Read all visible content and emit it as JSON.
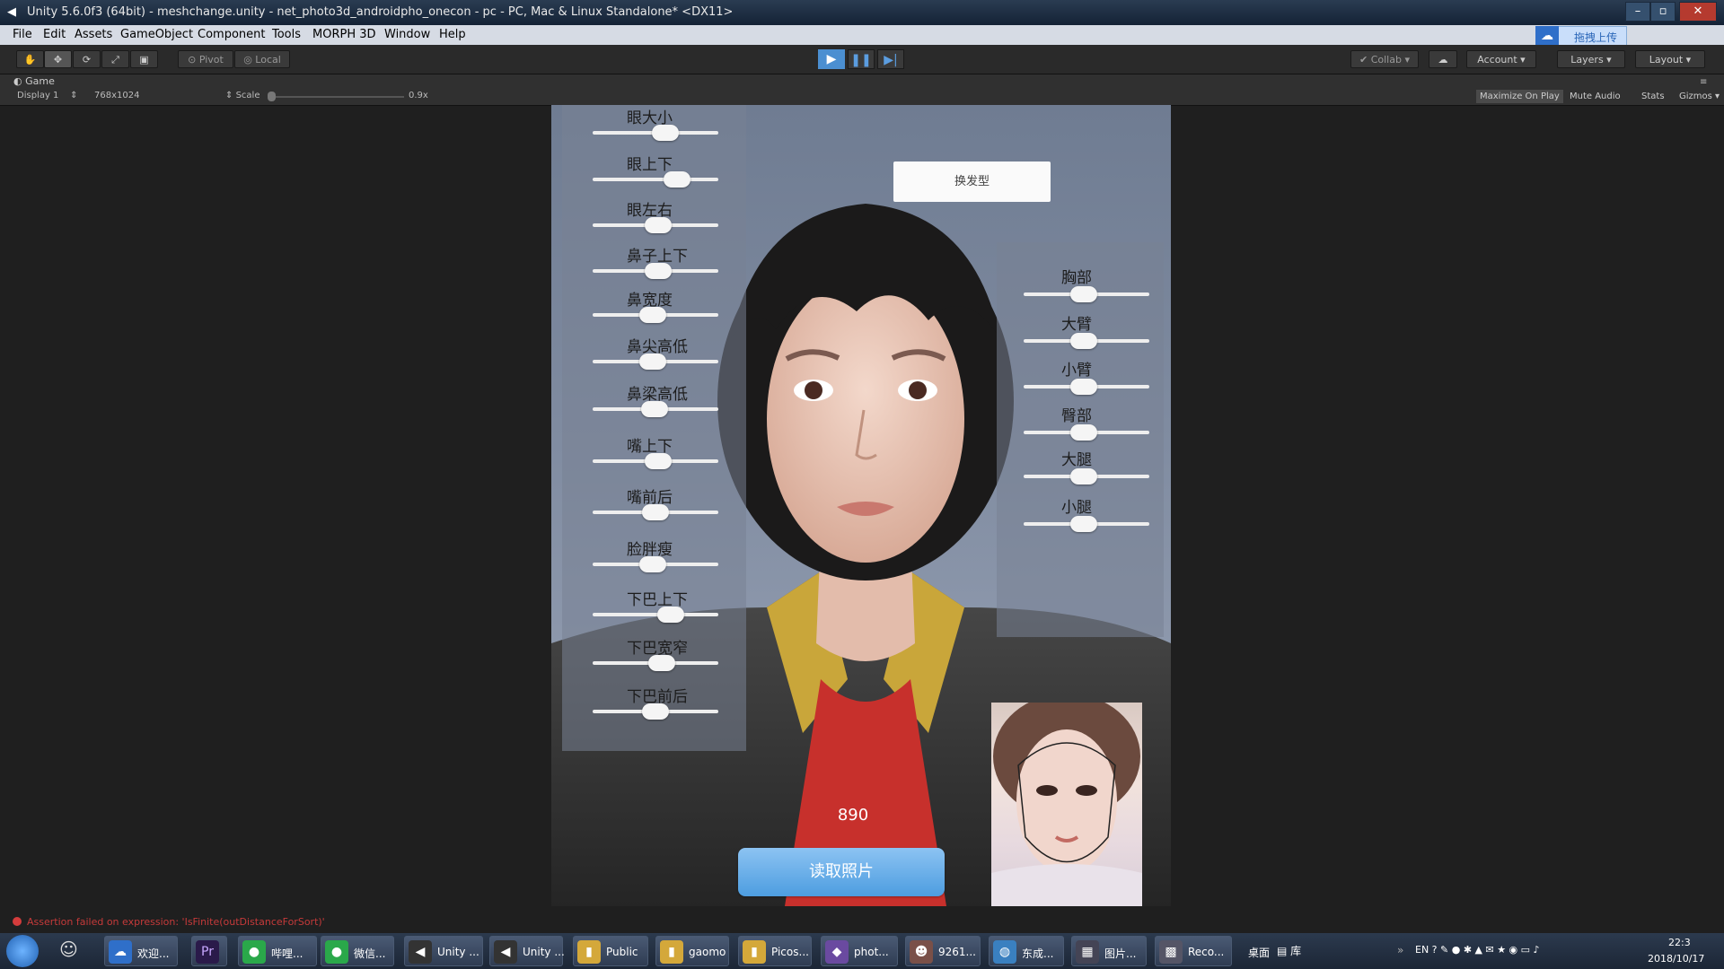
{
  "window": {
    "title": "Unity 5.6.0f3 (64bit) - meshchange.unity - net_photo3d_androidpho_onecon - pc - PC, Mac & Linux Standalone* <DX11>"
  },
  "menu": {
    "items": [
      "File",
      "Edit",
      "Assets",
      "GameObject",
      "Component",
      "Tools",
      "MORPH 3D",
      "Window",
      "Help"
    ],
    "cloud_label": "拖拽上传"
  },
  "toolbar": {
    "pivot": "Pivot",
    "local": "Local",
    "collab": "Collab",
    "account": "Account",
    "layers": "Layers",
    "layout": "Layout"
  },
  "game_view": {
    "tab": "Game",
    "display": "Display 1",
    "resolution": "768x1024",
    "scale_label": "Scale",
    "scale_value": "0.9x",
    "maximize_on_play": "Maximize On Play",
    "mute_audio": "Mute Audio",
    "stats": "Stats",
    "gizmos": "Gizmos"
  },
  "left_sliders": [
    {
      "label": "眼大小",
      "value": 0.58
    },
    {
      "label": "眼上下",
      "value": 0.67
    },
    {
      "label": "眼左右",
      "value": 0.52
    },
    {
      "label": "鼻子上下",
      "value": 0.52
    },
    {
      "label": "鼻宽度",
      "value": 0.48
    },
    {
      "label": "鼻尖高低",
      "value": 0.48
    },
    {
      "label": "鼻梁高低",
      "value": 0.49
    },
    {
      "label": "嘴上下",
      "value": 0.52
    },
    {
      "label": "嘴前后",
      "value": 0.5
    },
    {
      "label": "脸胖瘦",
      "value": 0.48
    },
    {
      "label": "下巴上下",
      "value": 0.62
    },
    {
      "label": "下巴宽窄",
      "value": 0.55
    },
    {
      "label": "下巴前后",
      "value": 0.5
    }
  ],
  "right_sliders": [
    {
      "label": "胸部",
      "value": 0.48
    },
    {
      "label": "大臂",
      "value": 0.48
    },
    {
      "label": "小臂",
      "value": 0.48
    },
    {
      "label": "臀部",
      "value": 0.48
    },
    {
      "label": "大腿",
      "value": 0.48
    },
    {
      "label": "小腿",
      "value": 0.48
    }
  ],
  "buttons": {
    "change_hair": "换发型",
    "read_photo": "读取照片"
  },
  "counter": "890",
  "status": {
    "error": "Assertion failed on expression: 'IsFinite(outDistanceForSort)'"
  },
  "taskbar": {
    "apps": [
      "欢迎...",
      "哔哩...",
      "微信...",
      "Unity ...",
      "Unity ...",
      "Public",
      "gaomo",
      "Picos...",
      "phot...",
      "9261...",
      "东成...",
      "图片...",
      "Reco..."
    ],
    "tray_desktop": "桌面",
    "tray_library": "库",
    "time": "22:3",
    "date": "2018/10/17"
  },
  "colors": {
    "unity_bg": "#1f1f1f",
    "play_active": "#4b8fd1",
    "read_photo_button": "#5aa6e6"
  }
}
